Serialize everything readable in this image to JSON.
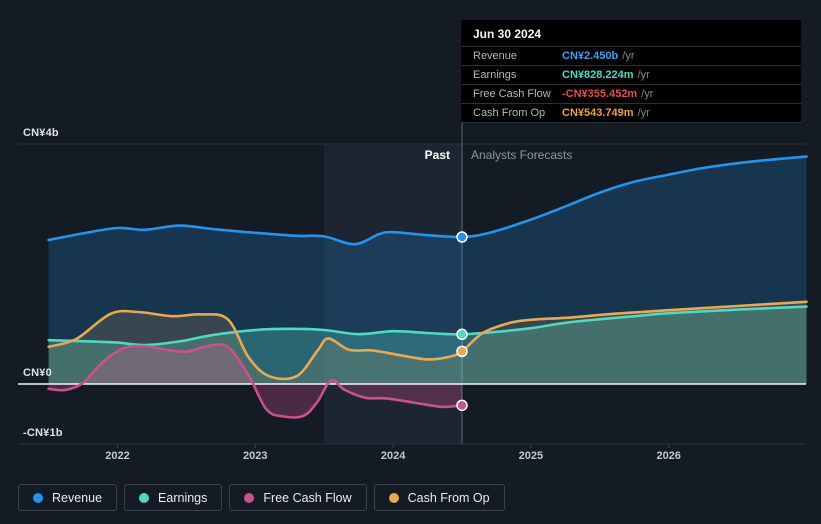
{
  "page": {
    "background": "#151b24"
  },
  "labels": {
    "past": "Past",
    "forecast": "Analysts Forecasts"
  },
  "tooltip": {
    "date": "Jun 30 2024",
    "rows": [
      {
        "label": "Revenue",
        "value": "CN¥2.450b",
        "suffix": "/yr",
        "color": "#3da0f2"
      },
      {
        "label": "Earnings",
        "value": "CN¥828.224m",
        "suffix": "/yr",
        "color": "#4ed9c6"
      },
      {
        "label": "Free Cash Flow",
        "value": "-CN¥355.452m",
        "suffix": "/yr",
        "color": "#e25147"
      },
      {
        "label": "Cash From Op",
        "value": "CN¥543.749m",
        "suffix": "/yr",
        "color": "#e8a33c"
      }
    ]
  },
  "chart_data": {
    "type": "line",
    "currency": "CN¥",
    "unit": "billions",
    "x_domain": [
      2021.5,
      2027.0
    ],
    "past_until": 2024.5,
    "highlight_band": [
      2023.5,
      2024.5
    ],
    "marker_date": "Jun 30 2024",
    "x_ticks": [
      2022,
      2023,
      2024,
      2025,
      2026
    ],
    "y_gridlines": [
      {
        "label": "CN¥4b",
        "value": 4
      },
      {
        "label": "CN¥0",
        "value": 0
      },
      {
        "label": "-CN¥1b",
        "value": -1
      }
    ],
    "series": [
      {
        "name": "Revenue",
        "color": "#2493ee",
        "fill": "rgba(36,147,238,0.22)",
        "marker_value": 2.45,
        "points": [
          [
            2021.5,
            2.4
          ],
          [
            2021.75,
            2.51
          ],
          [
            2022.0,
            2.6
          ],
          [
            2022.2,
            2.57
          ],
          [
            2022.45,
            2.64
          ],
          [
            2022.7,
            2.58
          ],
          [
            2023.0,
            2.52
          ],
          [
            2023.3,
            2.47
          ],
          [
            2023.5,
            2.46
          ],
          [
            2023.72,
            2.33
          ],
          [
            2023.9,
            2.5
          ],
          [
            2024.0,
            2.53
          ],
          [
            2024.25,
            2.48
          ],
          [
            2024.5,
            2.45
          ],
          [
            2024.7,
            2.52
          ],
          [
            2025.0,
            2.74
          ],
          [
            2025.25,
            2.96
          ],
          [
            2025.5,
            3.19
          ],
          [
            2025.75,
            3.37
          ],
          [
            2026.0,
            3.49
          ],
          [
            2026.25,
            3.6
          ],
          [
            2026.5,
            3.68
          ],
          [
            2026.75,
            3.74
          ],
          [
            2027.0,
            3.79
          ]
        ]
      },
      {
        "name": "Earnings",
        "color": "#52d7c2",
        "fill": "rgba(82,215,194,0.30)",
        "marker_value": 0.828224,
        "points": [
          [
            2021.5,
            0.73
          ],
          [
            2021.8,
            0.71
          ],
          [
            2022.0,
            0.69
          ],
          [
            2022.2,
            0.65
          ],
          [
            2022.45,
            0.71
          ],
          [
            2022.7,
            0.82
          ],
          [
            2023.0,
            0.9
          ],
          [
            2023.25,
            0.92
          ],
          [
            2023.5,
            0.9
          ],
          [
            2023.75,
            0.83
          ],
          [
            2024.0,
            0.88
          ],
          [
            2024.25,
            0.85
          ],
          [
            2024.5,
            0.828224
          ],
          [
            2024.75,
            0.87
          ],
          [
            2025.0,
            0.93
          ],
          [
            2025.25,
            1.02
          ],
          [
            2025.5,
            1.08
          ],
          [
            2025.75,
            1.13
          ],
          [
            2026.0,
            1.18
          ],
          [
            2026.5,
            1.24
          ],
          [
            2027.0,
            1.29
          ]
        ]
      },
      {
        "name": "Free Cash Flow",
        "color": "#c9518f",
        "fill": "rgba(201,81,143,0.30)",
        "marker_value": -0.355452,
        "ends_at_marker": true,
        "points": [
          [
            2021.5,
            -0.08
          ],
          [
            2021.62,
            -0.1
          ],
          [
            2021.75,
            0.02
          ],
          [
            2021.9,
            0.38
          ],
          [
            2022.05,
            0.6
          ],
          [
            2022.2,
            0.63
          ],
          [
            2022.35,
            0.57
          ],
          [
            2022.5,
            0.54
          ],
          [
            2022.65,
            0.63
          ],
          [
            2022.8,
            0.62
          ],
          [
            2022.95,
            0.15
          ],
          [
            2023.08,
            -0.42
          ],
          [
            2023.2,
            -0.54
          ],
          [
            2023.35,
            -0.53
          ],
          [
            2023.45,
            -0.3
          ],
          [
            2023.55,
            0.06
          ],
          [
            2023.65,
            -0.1
          ],
          [
            2023.8,
            -0.23
          ],
          [
            2023.95,
            -0.24
          ],
          [
            2024.15,
            -0.31
          ],
          [
            2024.35,
            -0.38
          ],
          [
            2024.5,
            -0.355452
          ]
        ]
      },
      {
        "name": "Cash From Op",
        "color": "#e9a851",
        "fill": "rgba(233,168,81,0.15)",
        "marker_value": 0.543749,
        "points": [
          [
            2021.5,
            0.62
          ],
          [
            2021.7,
            0.75
          ],
          [
            2021.95,
            1.17
          ],
          [
            2022.15,
            1.2
          ],
          [
            2022.4,
            1.13
          ],
          [
            2022.6,
            1.16
          ],
          [
            2022.8,
            1.08
          ],
          [
            2022.95,
            0.45
          ],
          [
            2023.1,
            0.13
          ],
          [
            2023.3,
            0.13
          ],
          [
            2023.45,
            0.55
          ],
          [
            2023.53,
            0.76
          ],
          [
            2023.68,
            0.57
          ],
          [
            2023.85,
            0.56
          ],
          [
            2024.05,
            0.48
          ],
          [
            2024.25,
            0.41
          ],
          [
            2024.4,
            0.45
          ],
          [
            2024.5,
            0.543749
          ],
          [
            2024.65,
            0.85
          ],
          [
            2024.85,
            1.02
          ],
          [
            2025.0,
            1.07
          ],
          [
            2025.3,
            1.11
          ],
          [
            2025.6,
            1.17
          ],
          [
            2026.0,
            1.23
          ],
          [
            2026.5,
            1.3
          ],
          [
            2027.0,
            1.37
          ]
        ]
      }
    ]
  }
}
